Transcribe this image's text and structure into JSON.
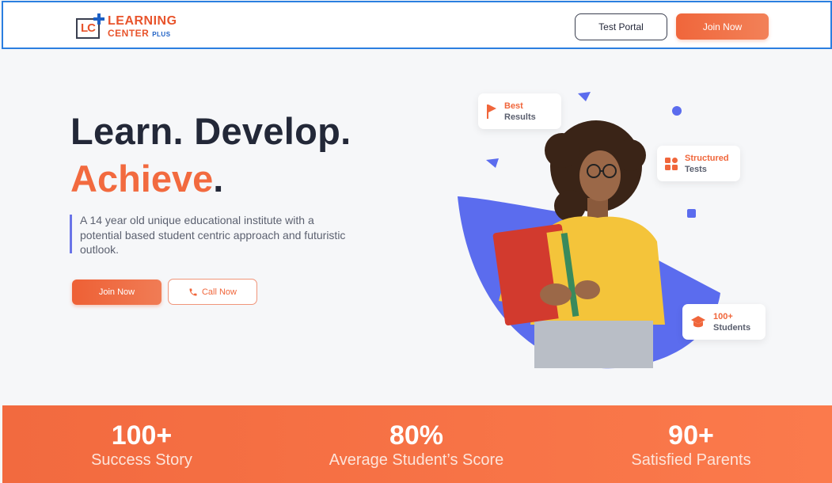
{
  "header": {
    "logo": {
      "mark": "LC",
      "line1": "LEARNING",
      "line2": "CENTER",
      "line3": "PLUS"
    },
    "test_portal_label": "Test Portal",
    "join_now_label": "Join Now"
  },
  "hero": {
    "headline_line1": "Learn. Develop.",
    "headline_accent": "Achieve",
    "headline_period": ".",
    "description": "A 14 year old unique educational institute with a potential based student centric approach and futuristic outlook.",
    "join_now_label": "Join Now",
    "call_now_label": "Call Now"
  },
  "badges": {
    "best": {
      "line1": "Best",
      "line2": "Results",
      "icon": "flag-icon"
    },
    "structured": {
      "line1": "Structured",
      "line2": "Tests",
      "icon": "grid-icon"
    },
    "students": {
      "line1": "100+",
      "line2": "Students",
      "icon": "graduation-cap-icon"
    }
  },
  "stats": [
    {
      "value": "100+",
      "label": "Success Story"
    },
    {
      "value": "80%",
      "label": "Average Student’s Score"
    },
    {
      "value": "90+",
      "label": "Satisfied Parents"
    }
  ],
  "colors": {
    "accent": "#f26a3f",
    "brand_blue": "#5b6ef0",
    "dark": "#232838"
  }
}
